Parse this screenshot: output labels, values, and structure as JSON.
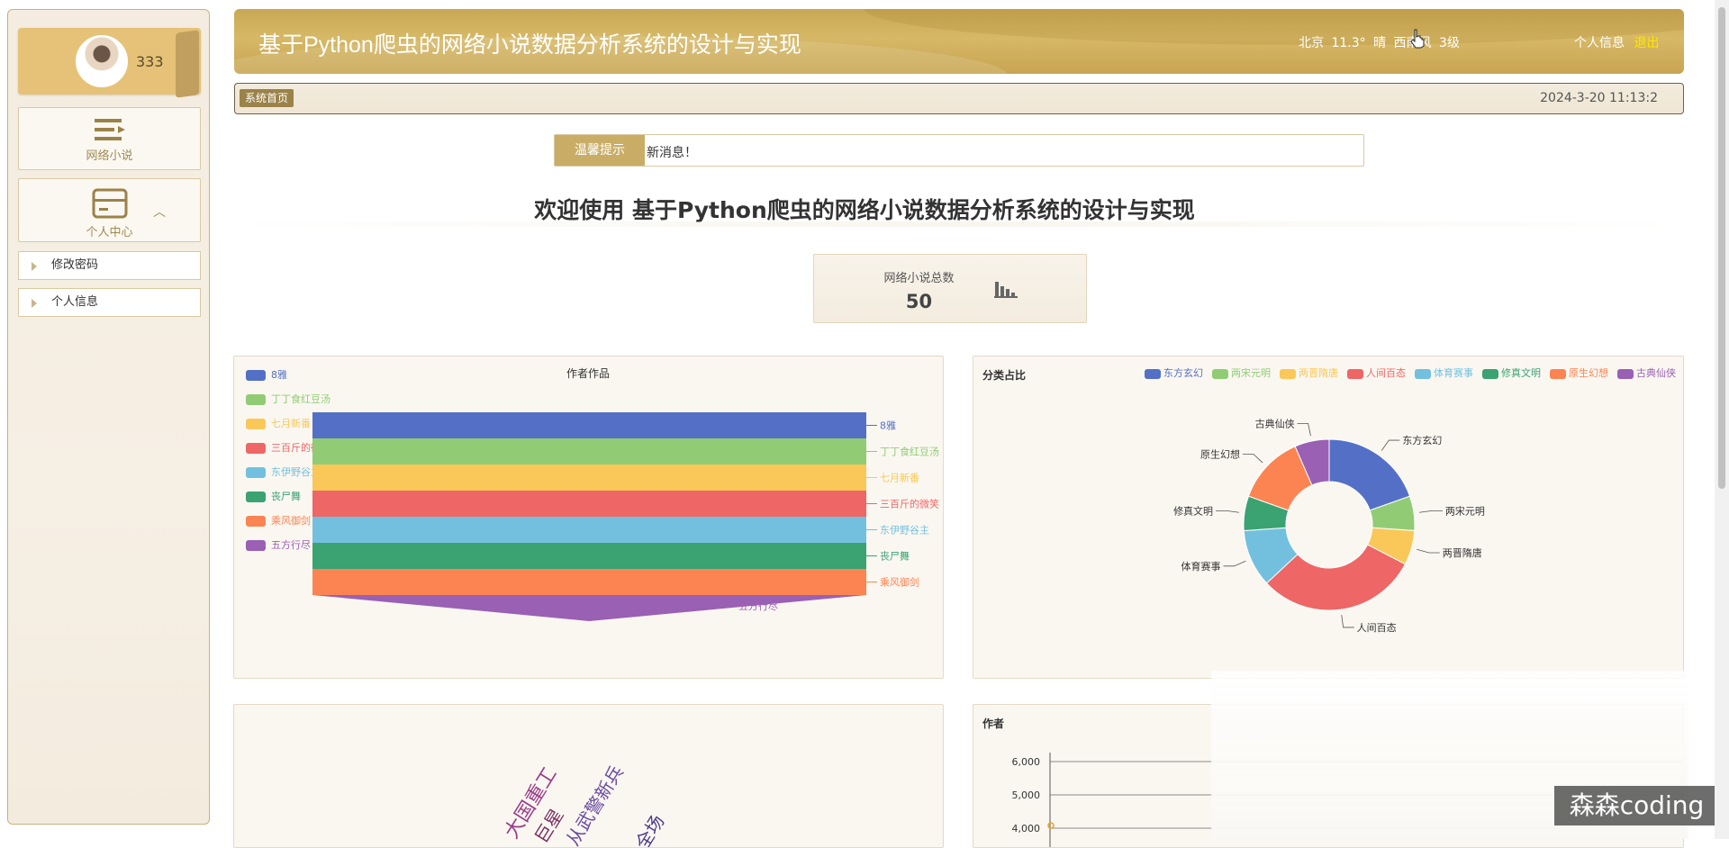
{
  "sidebar": {
    "username": "333",
    "menu": [
      {
        "label": "网络小说",
        "icon": "list-icon"
      },
      {
        "label": "个人中心",
        "icon": "card-icon"
      }
    ],
    "sub_items": [
      "修改密码",
      "个人信息"
    ]
  },
  "header": {
    "title": "基于Python爬虫的网络小说数据分析系统的设计与实现",
    "weather": "北京  11.3°  晴  西南风  3级",
    "profile_link": "个人信息",
    "logout_link": "退出"
  },
  "breadcrumb": {
    "home": "系统首页",
    "datetime": "2024-3-20 11:13:2"
  },
  "notice": {
    "label": "温馨提示",
    "message": "新消息！"
  },
  "welcome": "欢迎使用 基于Python爬虫的网络小说数据分析系统的设计与实现",
  "stat": {
    "label": "网络小说总数",
    "value": "50"
  },
  "colors": {
    "c1": "#5470c6",
    "c2": "#91cc75",
    "c3": "#fac858",
    "c4": "#ee6666",
    "c5": "#73c0de",
    "c6": "#3ba272",
    "c7": "#fc8452",
    "c8": "#9a60b4",
    "accent": "#c9ad67"
  },
  "chart_data": [
    {
      "type": "funnel",
      "title": "作者作品",
      "categories": [
        "8雅",
        "丁丁食红豆汤",
        "七月新番",
        "三百斤的微笑",
        "东伊野谷主",
        "丧尸舞",
        "乘风御剑",
        "五方行尽"
      ],
      "values": [
        1,
        1,
        1,
        1,
        1,
        1,
        1,
        1
      ]
    },
    {
      "type": "pie",
      "title": "分类占比",
      "categories": [
        "东方玄幻",
        "两宋元明",
        "两晋隋唐",
        "人间百态",
        "体育赛事",
        "修真文明",
        "原生幻想",
        "古典仙侠"
      ],
      "values": [
        9,
        3,
        3,
        14,
        5,
        3,
        6,
        3
      ]
    },
    {
      "type": "wordcloud",
      "words": [
        "大国重工",
        "从武警新兵",
        "全场",
        "巨星"
      ]
    },
    {
      "type": "line",
      "title": "作者",
      "yticks": [
        "6,000",
        "5,000",
        "4,000"
      ],
      "ylim": [
        4000,
        6000
      ]
    }
  ],
  "watermark": "森森coding"
}
